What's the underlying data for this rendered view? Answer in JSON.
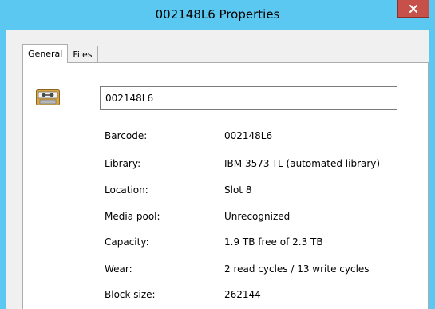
{
  "window": {
    "title": "002148L6 Properties",
    "accent_color": "#5ac8f0",
    "close_color": "#c7504b"
  },
  "tabs": [
    {
      "label": "General",
      "selected": true
    },
    {
      "label": "Files",
      "selected": false
    }
  ],
  "general": {
    "media_icon": "tape-cartridge-icon",
    "name_value": "002148L6",
    "properties": [
      {
        "label": "Barcode:",
        "value": "002148L6"
      },
      {
        "label": "Library:",
        "value": "IBM 3573-TL (automated library)"
      },
      {
        "label": "Location:",
        "value": "Slot 8"
      },
      {
        "label": "Media pool:",
        "value": "Unrecognized"
      },
      {
        "label": "Capacity:",
        "value": "1.9 TB free of 2.3 TB"
      },
      {
        "label": "Wear:",
        "value": "2 read cycles / 13 write cycles"
      },
      {
        "label": "Block size:",
        "value": "262144"
      }
    ]
  }
}
